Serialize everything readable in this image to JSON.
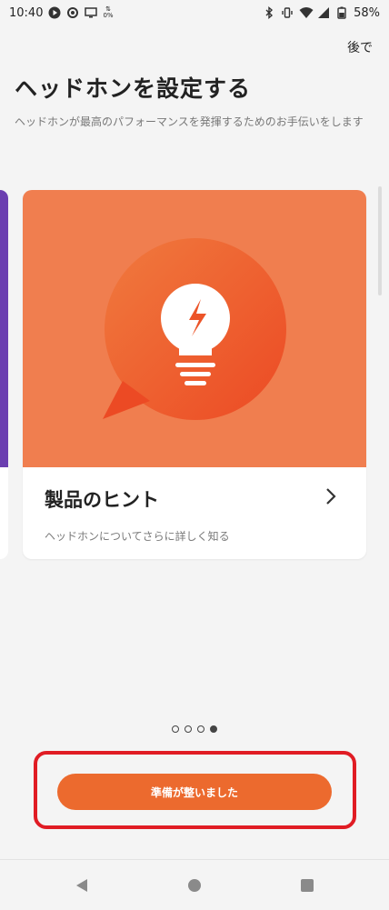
{
  "status_bar": {
    "time": "10:40",
    "data_rate": "0%",
    "battery": "58%"
  },
  "header": {
    "later_label": "後で",
    "title": "ヘッドホンを設定する",
    "subtitle": "ヘッドホンが最高のパフォーマンスを発揮するためのお手伝いをします"
  },
  "card": {
    "title": "製品のヒント",
    "subtitle": "ヘッドホンについてさらに詳しく知る",
    "icon": "lightbulb-speech-bubble-icon",
    "hero_color": "#f07e4f"
  },
  "pager": {
    "count": 4,
    "active_index": 3
  },
  "primary_button": {
    "label": "準備が整いました",
    "color": "#ec6a2e"
  },
  "highlight_color": "#e01c24"
}
